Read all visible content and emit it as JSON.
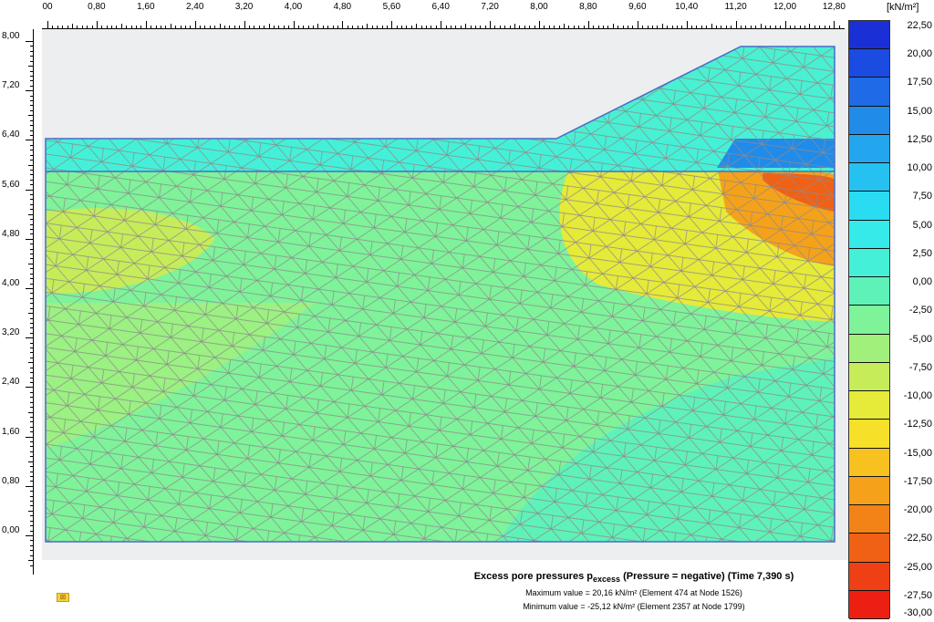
{
  "ruler": {
    "x_ticks": [
      "00",
      "0,80",
      "1,60",
      "2,40",
      "3,20",
      "4,00",
      "4,80",
      "5,60",
      "6,40",
      "7,20",
      "8,00",
      "8,80",
      "9,60",
      "10,40",
      "11,20",
      "12,00",
      "12,80"
    ],
    "y_ticks": [
      "8,00",
      "7,20",
      "6,40",
      "5,60",
      "4,80",
      "4,00",
      "3,20",
      "2,40",
      "1,60",
      "0,80",
      "0,00"
    ]
  },
  "legend": {
    "unit_label": "[kN/m²]",
    "values": [
      "22,50",
      "20,00",
      "17,50",
      "15,00",
      "12,50",
      "10,00",
      "7,50",
      "5,00",
      "2,50",
      "0,00",
      "-2,50",
      "-5,00",
      "-7,50",
      "-10,00",
      "-12,50",
      "-15,00",
      "-17,50",
      "-20,00",
      "-22,50",
      "-25,00",
      "-27,50",
      "-30,00"
    ],
    "colors": [
      "#1a2fd6",
      "#1b4be0",
      "#1f6ae6",
      "#218bea",
      "#23a6ee",
      "#25c2f1",
      "#2adcf2",
      "#37eaea",
      "#45f0d8",
      "#5ef2b8",
      "#7ef39a",
      "#a2f07c",
      "#c6ec5a",
      "#e6ea38",
      "#f7e02a",
      "#f7c21f",
      "#f5a21a",
      "#f38217",
      "#f06115",
      "#ee4014",
      "#eb2013"
    ]
  },
  "info": {
    "title_main": "Excess pore pressures p",
    "title_sub": "excess",
    "title_rest": " (Pressure = negative) (Time 7,390 s)",
    "max_line": "Maximum value = 20,16 kN/m² (Element 474 at Node 1526)",
    "min_line": "Minimum value = -25,12 kN/m² (Element 2357 at Node 1799)"
  },
  "model_icon": "plaxis-model-icon"
}
